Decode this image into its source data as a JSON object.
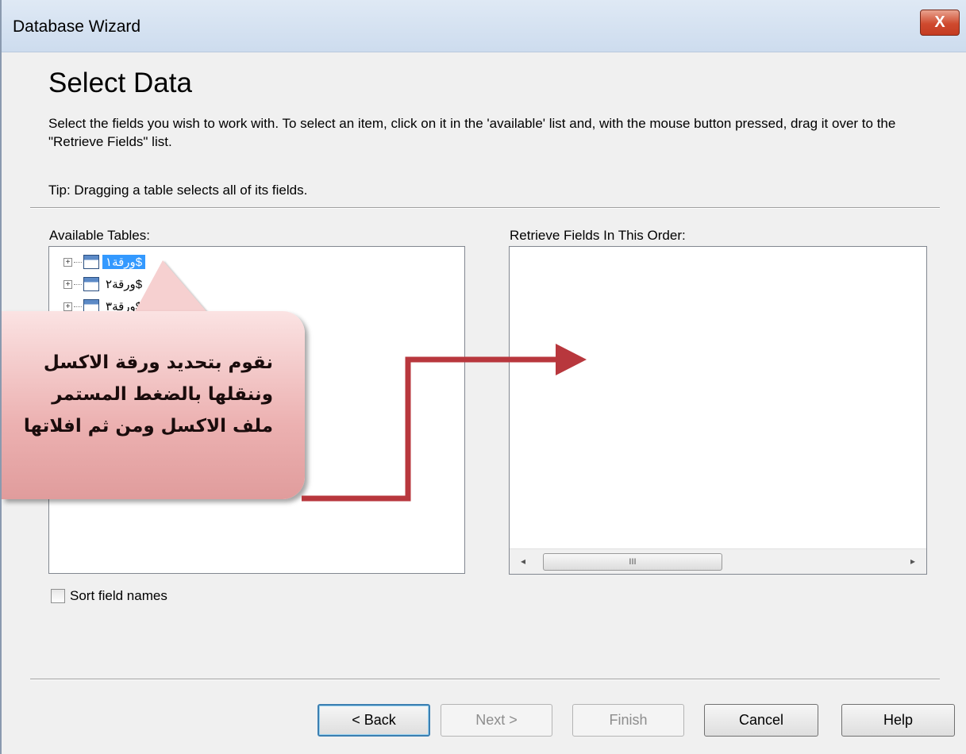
{
  "window": {
    "title": "Database Wizard",
    "close_glyph": "X"
  },
  "header": {
    "title": "Select Data",
    "description": "Select the fields you wish to work with. To select an item, click on it in the 'available' list and, with the mouse button pressed, drag it over to the \"Retrieve Fields\" list.",
    "tip": "Tip: Dragging a table selects all of its fields."
  },
  "available_tables": {
    "label": "Available Tables:",
    "items": [
      {
        "label": "ورقة١$",
        "selected": true
      },
      {
        "label": "ورقة٢$",
        "selected": false
      },
      {
        "label": "ورقة٣$",
        "selected": false
      }
    ]
  },
  "retrieve_fields": {
    "label": "Retrieve Fields In This Order:",
    "scroll_left": "◂",
    "scroll_right": "▸",
    "scroll_grip": "III"
  },
  "sort_checkbox": {
    "label": "Sort field names",
    "checked": false
  },
  "buttons": {
    "back": "< Back",
    "next": "Next >",
    "finish": "Finish",
    "cancel": "Cancel",
    "help": "Help"
  },
  "callout": {
    "line1": "نقوم بتحديد ورقة الاكسل",
    "line2": "وننقلها بالضغط المستمر",
    "line3": "ملف الاكسل ومن ثم افلاتها",
    "color": "#ecb1b1",
    "arrow_color": "#b8373d"
  }
}
